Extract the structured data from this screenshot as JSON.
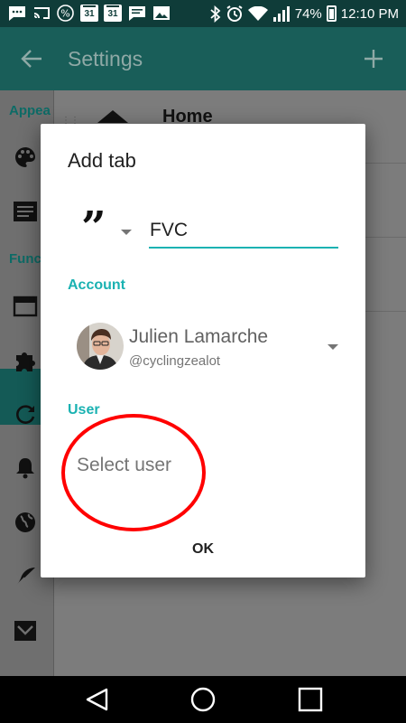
{
  "status_bar": {
    "battery": "74%",
    "time": "12:10 PM",
    "calendar_day_1": "31",
    "calendar_day_2": "31",
    "icons": [
      "message-icon",
      "cast-icon",
      "percent-icon",
      "calendar-icon",
      "calendar-icon",
      "chat-icon",
      "image-icon",
      "bluetooth-icon",
      "alarm-icon",
      "wifi-icon",
      "signal-icon",
      "battery-icon"
    ]
  },
  "toolbar": {
    "title": "Settings",
    "back_icon": "arrow-left-icon",
    "add_icon": "plus-icon"
  },
  "background": {
    "section_1": "Appea",
    "section_2": "Func",
    "home_label": "Home",
    "sidebar_icons": [
      "palette-icon",
      "list-icon",
      "tab-icon",
      "puzzle-icon",
      "refresh-icon",
      "bell-icon",
      "globe-icon",
      "feather-icon",
      "inbox-icon"
    ]
  },
  "dialog": {
    "title": "Add tab",
    "tab_type_icon": "quote-icon",
    "tab_name_value": "FVC",
    "account_label": "Account",
    "account": {
      "name": "Julien Lamarche",
      "handle": "@cyclingzealot"
    },
    "user_label": "User",
    "user_placeholder": "Select user",
    "ok_label": "OK"
  },
  "colors": {
    "accent": "#1ab2b2",
    "toolbar": "#195e59",
    "status_bar": "#0f3c39",
    "annotation": "#ff0000"
  },
  "nav_bar": {
    "icons": [
      "back-triangle-icon",
      "home-circle-icon",
      "recents-square-icon"
    ]
  }
}
